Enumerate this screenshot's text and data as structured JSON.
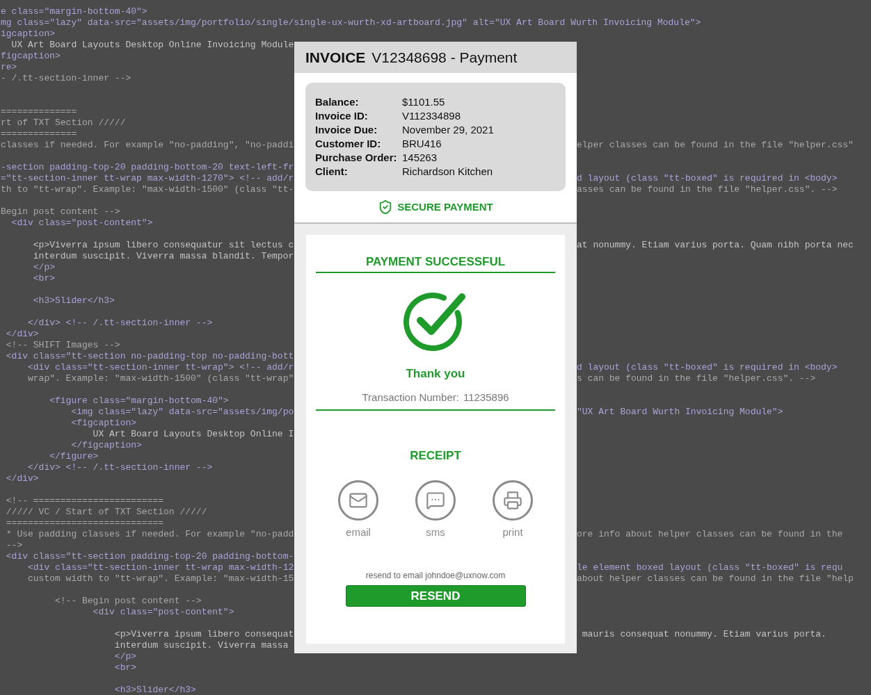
{
  "editor": {
    "lines": [
      {
        "kind": "markup",
        "left": "e class=\"margin-bottom-40\">"
      },
      {
        "kind": "markup",
        "left": "mg class=\"lazy\" data-src=\"assets/img/portfolio/single/single-ux-wurth-xd-artboard.jpg\" alt=\"UX Art Board Wurth Invoicing Module\">"
      },
      {
        "kind": "markup",
        "left": "igcaption>"
      },
      {
        "kind": "text",
        "left": "  UX Art Board Layouts Desktop Online Invoicing Module"
      },
      {
        "kind": "markup",
        "left": "figcaption>"
      },
      {
        "kind": "markup",
        "left": "re>"
      },
      {
        "kind": "comment",
        "left": "- /.tt-section-inner -->"
      },
      {
        "kind": "blank"
      },
      {
        "kind": "blank"
      },
      {
        "kind": "comment",
        "left": "=============="
      },
      {
        "kind": "comment",
        "left": "rt of TXT Section /////"
      },
      {
        "kind": "comment",
        "left": "=============="
      },
      {
        "kind": "comment",
        "left": "classes if needed. For example \"no-padding\", \"no-paddi",
        "right": "elper classes can be found in the file \"helper.css\""
      },
      {
        "kind": "blank"
      },
      {
        "kind": "markup",
        "left": "-section padding-top-20 padding-bottom-20 text-left-fr"
      },
      {
        "kind": "markup",
        "left": "=\"tt-section-inner tt-wrap max-width-1270\"> <!-- add/r",
        "right": "d layout (class \"tt-boxed\" is required in <body>"
      },
      {
        "kind": "comment",
        "left": "th to \"tt-wrap\". Example: \"max-width-1500\" (class \"tt-",
        "right": "asses can be found in the file \"helper.css\". -->"
      },
      {
        "kind": "blank"
      },
      {
        "kind": "comment",
        "left": "Begin post content -->"
      },
      {
        "kind": "markup",
        "left": "  <div class=\"post-content\">"
      },
      {
        "kind": "blank"
      },
      {
        "kind": "text",
        "left": "      <p>Viverra ipsum libero consequatur sit lectus c",
        "right": "at nonummy. Etiam varius porta. Quam nibh porta nec"
      },
      {
        "kind": "text",
        "left": "      interdum suscipit. Viverra massa blandit. Tempor"
      },
      {
        "kind": "markup",
        "left": "      </p>"
      },
      {
        "kind": "markup",
        "left": "      <br>"
      },
      {
        "kind": "blank"
      },
      {
        "kind": "markup",
        "left": "      <h3>Slider</h3>"
      },
      {
        "kind": "blank"
      },
      {
        "kind": "markup",
        "left": "     </div> <!-- /.tt-section-inner -->"
      },
      {
        "kind": "markup",
        "left": " </div>"
      },
      {
        "kind": "comment",
        "left": " <!-- SHIFT Images -->"
      },
      {
        "kind": "markup",
        "left": " <div class=\"tt-section no-padding-top no-padding-bott"
      },
      {
        "kind": "markup",
        "left": "     <div class=\"tt-section-inner tt-wrap\"> <!-- add/r",
        "right": "d layout (class \"tt-boxed\" is required in <body>"
      },
      {
        "kind": "comment",
        "left": "     wrap\". Example: \"max-width-1500\" (class \"tt-wrap\"",
        "right": "s can be found in the file \"helper.css\". -->"
      },
      {
        "kind": "blank"
      },
      {
        "kind": "markup",
        "left": "         <figure class=\"margin-bottom-40\">"
      },
      {
        "kind": "markup",
        "left": "             <img class=\"lazy\" data-src=\"assets/img/po",
        "right": "\"UX Art Board Wurth Invoicing Module\">"
      },
      {
        "kind": "markup",
        "left": "             <figcaption>"
      },
      {
        "kind": "text",
        "left": "                 UX Art Board Layouts Desktop Online I"
      },
      {
        "kind": "markup",
        "left": "             </figcaption>"
      },
      {
        "kind": "markup",
        "left": "         </figure>"
      },
      {
        "kind": "markup",
        "left": "     </div> <!-- /.tt-section-inner -->"
      },
      {
        "kind": "markup",
        "left": " </div>"
      },
      {
        "kind": "blank"
      },
      {
        "kind": "comment",
        "left": " <!-- ========================"
      },
      {
        "kind": "comment",
        "left": " ///// VC / Start of TXT Section /////"
      },
      {
        "kind": "comment",
        "left": " ============================="
      },
      {
        "kind": "comment",
        "left": " * Use padding classes if needed. For example \"no-padd",
        "right": "ore info about helper classes can be found in the"
      },
      {
        "kind": "comment",
        "left": " -->"
      },
      {
        "kind": "markup",
        "left": " <div class=\"tt-section padding-top-20 padding-bottom-"
      },
      {
        "kind": "markup",
        "left": "     <div class=\"tt-section-inner tt-wrap max-width-12",
        "right": "le element boxed layout (class \"tt-boxed\" is requ"
      },
      {
        "kind": "comment",
        "left": "     custom width to \"tt-wrap\". Example: \"max-width-15",
        "right": "about helper classes can be found in the file \"help"
      },
      {
        "kind": "blank"
      },
      {
        "kind": "comment",
        "left": "          <!-- Begin post content -->"
      },
      {
        "kind": "markup",
        "left": "                 <div class=\"post-content\">"
      },
      {
        "kind": "blank"
      },
      {
        "kind": "text",
        "left": "                     <p>Viverra ipsum libero consequat",
        "right": " mauris consequat nonummy. Etiam varius porta."
      },
      {
        "kind": "text",
        "left": "                     interdum suscipit. Viverra massa"
      },
      {
        "kind": "markup",
        "left": "                     </p>"
      },
      {
        "kind": "markup",
        "left": "                     <br>"
      },
      {
        "kind": "blank"
      },
      {
        "kind": "markup",
        "left": "                     <h3>Slider</h3>"
      }
    ]
  },
  "dialog": {
    "title_label": "INVOICE",
    "title": "V12348698 - Payment",
    "details": [
      {
        "label": "Balance:",
        "value": "$1101.55"
      },
      {
        "label": "Invoice ID:",
        "value": "V112334898"
      },
      {
        "label": "Invoice Due:",
        "value": "November 29, 2021"
      },
      {
        "label": "Customer ID:",
        "value": "BRU416"
      },
      {
        "label": "Purchase Order:",
        "value": "145263"
      },
      {
        "label": "Client:",
        "value": "Richardson Kitchen"
      }
    ],
    "secure_label": "SECURE PAYMENT",
    "status": "PAYMENT SUCCESSFUL",
    "thanks": "Thank you",
    "transaction_label": "Transaction Number:",
    "transaction_number": "11235896",
    "receipt_title": "RECEIPT",
    "receipt_options": [
      {
        "kind": "email",
        "label": "email"
      },
      {
        "kind": "sms",
        "label": "sms"
      },
      {
        "kind": "print",
        "label": "print"
      }
    ],
    "resend_note": "resend to email johndoe@uxnow.com",
    "resend_button": "RESEND"
  }
}
